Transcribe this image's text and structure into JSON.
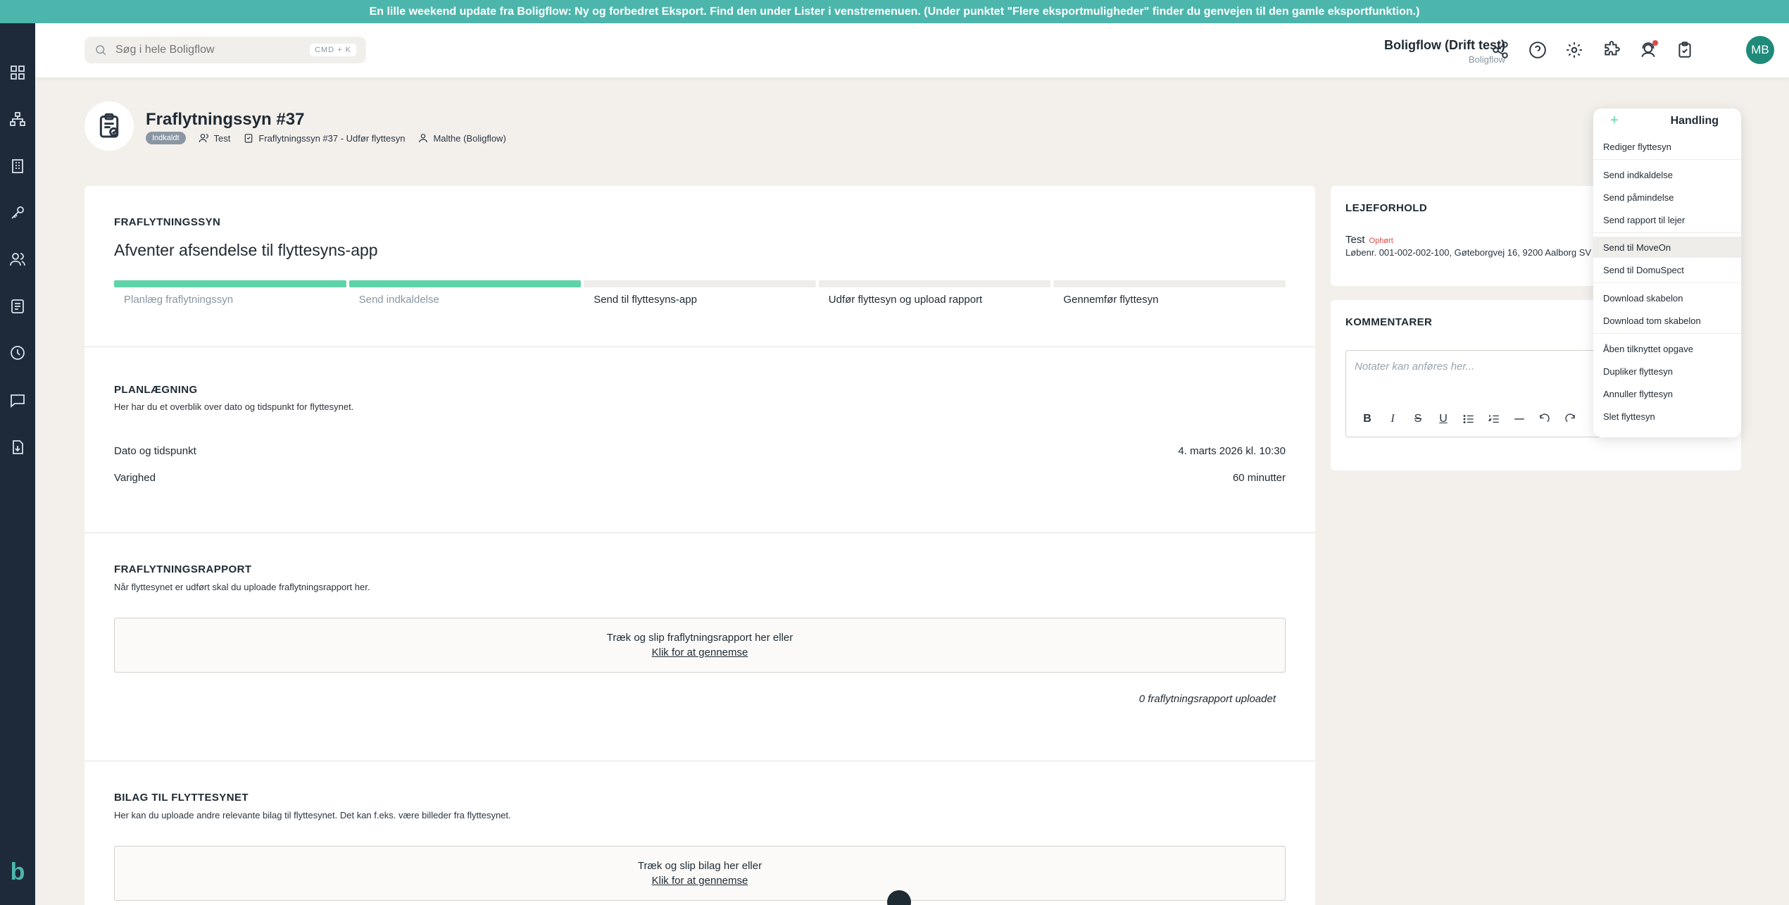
{
  "banner": {
    "text": "En lille weekend update fra Boligflow: Ny og forbedret Eksport. Find den under Lister i venstremenuen. (Under punktet \"Flere eksportmuligheder\" finder du genvejen til den gamle eksportfunktion.)"
  },
  "sidebar": {
    "items": [
      "dashboard-icon",
      "org-chart-icon",
      "building-icon",
      "key-icon",
      "users-icon",
      "document-list-icon",
      "clock-icon",
      "chat-icon",
      "file-download-icon"
    ],
    "logo": "b"
  },
  "topbar": {
    "search_placeholder": "Søg i hele Boligflow",
    "search_shortcut": "CMD + K",
    "company_name": "Boligflow (Drift test)",
    "company_sub": "Boligflow",
    "avatar_initials": "MB"
  },
  "header": {
    "title": "Fraflytningssyn #37",
    "badge": "Indkaldt",
    "person": "Test",
    "task": "Fraflytningssyn #37 - Udfør flyttesyn",
    "owner": "Malthe (Boligflow)"
  },
  "status_section": {
    "title": "FRAFLYTNINGSSYN",
    "status": "Afventer afsendelse til flyttesyns-app",
    "steps": [
      {
        "label": "Planlæg fraflytningssyn",
        "done": true
      },
      {
        "label": "Send indkaldelse",
        "done": true
      },
      {
        "label": "Send til flyttesyns-app",
        "done": false
      },
      {
        "label": "Udfør flyttesyn og upload rapport",
        "done": false
      },
      {
        "label": "Gennemfør flyttesyn",
        "done": false
      }
    ]
  },
  "planning": {
    "title": "PLANLÆGNING",
    "desc": "Her har du et overblik over dato og tidspunkt for flyttesynet.",
    "date_label": "Dato og tidspunkt",
    "date_value": "4. marts 2026 kl. 10:30",
    "duration_label": "Varighed",
    "duration_value": "60 minutter"
  },
  "report": {
    "title": "FRAFLYTNINGSRAPPORT",
    "desc": "Når flyttesynet er udført skal du uploade fraflytningsrapport her.",
    "drop_text": "Træk og slip fraflytningsrapport her eller",
    "drop_link": "Klik for at gennemse",
    "count": "0 fraflytningsrapport uploadet"
  },
  "attachments": {
    "title": "BILAG TIL FLYTTESYNET",
    "desc": "Her kan du uploade andre relevante bilag til flyttesynet. Det kan f.eks. være billeder fra flyttesynet.",
    "drop_text": "Træk og slip bilag her eller",
    "drop_link": "Klik for at gennemse"
  },
  "tenancy": {
    "title": "LEJEFORHOLD",
    "tenant": "Test",
    "tenant_status": "Ophørt",
    "address": "Løbenr. 001-002-002-100, Gøteborgvej 16, 9200 Aalborg SV"
  },
  "comments": {
    "title": "KOMMENTARER",
    "placeholder": "Notater kan anføres her..."
  },
  "action_menu": {
    "label": "Handling",
    "groups": [
      [
        "Rediger flyttesyn"
      ],
      [
        "Send indkaldelse",
        "Send påmindelse",
        "Send rapport til lejer"
      ],
      [
        "Send til MoveOn",
        "Send til DomuSpect"
      ],
      [
        "Download skabelon",
        "Download tom skabelon"
      ],
      [
        "Åben tilknyttet opgave",
        "Dupliker flyttesyn",
        "Annuller flyttesyn",
        "Slet flyttesyn"
      ]
    ]
  }
}
